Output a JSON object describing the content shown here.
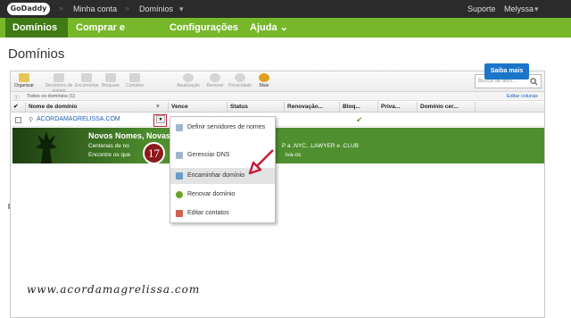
{
  "topbar": {
    "logo": "GoDaddy",
    "crumbs": [
      "Minha conta",
      "Domínios"
    ],
    "support": "Suporte",
    "user": "Melyssa"
  },
  "nav": {
    "items": [
      {
        "label": "Domínios",
        "active": true
      },
      {
        "label": "Comprar e Vender"
      },
      {
        "label": "Configurações"
      },
      {
        "label": "Ajuda"
      }
    ]
  },
  "page": {
    "title": "Domínios"
  },
  "toolbar": {
    "organize": "Organizar",
    "nameservers": "Servidores de nomes",
    "forward": "Encaminhar",
    "lock": "Bloquear",
    "contacts": "Contatos",
    "update": "Atualização",
    "renew": "Renovar",
    "privacy": "Privacidade",
    "more": "Mais",
    "search_placeholder": "Busca de dom..."
  },
  "subbar": {
    "all_domains": "Todos os domínios (1)",
    "edit_columns": "Editar colunas"
  },
  "columns": [
    "Nome de domínio",
    "Vence",
    "Status",
    "Renovação...",
    "Bloq...",
    "Priva...",
    "Domínio cer..."
  ],
  "rows": [
    {
      "domain": "ACORDAMAGRELISSA.COM",
      "locked": true
    }
  ],
  "banner": {
    "headline": "Novos Nomes, Novas O",
    "line1": "Centenas de no",
    "line1_tail": "P a .NYC, .LAWYER e .CLUB",
    "line2": "Encontre os que",
    "line2_tail": "lva-os",
    "cta": "Saiba mais"
  },
  "menu": {
    "items": [
      {
        "label": "Definir servidores de nomes"
      },
      {
        "label": "Gerenciar DNS"
      },
      {
        "label": "Encaminhar domínio",
        "highlight": true
      },
      {
        "label": "Renovar domínio"
      },
      {
        "label": "Editar contatos"
      }
    ]
  },
  "annotation": {
    "step": "17"
  },
  "watermark": "www.acordamagrelissa.com",
  "colors": {
    "accent_green": "#76b82a",
    "nav_active": "#3f7a14",
    "cta_blue": "#1b76c9",
    "annotation_red": "#c31d3a"
  }
}
